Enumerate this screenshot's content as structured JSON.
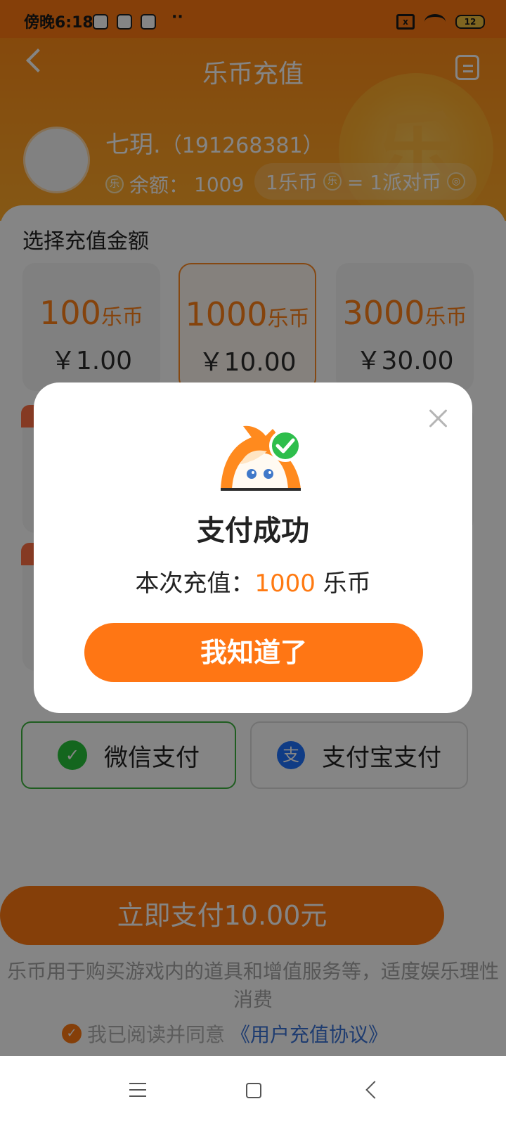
{
  "status_bar": {
    "time": "傍晚6:18",
    "dots": "··",
    "battery": "12",
    "sim": "x"
  },
  "header": {
    "title": "乐币充值",
    "username": "七玥.",
    "user_id": "（191268381）",
    "balance_label": "余额：",
    "balance": "1009",
    "rate_left": "1乐币",
    "rate_right": "= 1派对币",
    "coin_symbol": "乐"
  },
  "recharge": {
    "section_title": "选择充值金额",
    "packages": [
      {
        "coins": "100",
        "unit": "乐币",
        "price": "￥1.00"
      },
      {
        "coins": "1000",
        "unit": "乐币",
        "price": "￥10.00"
      },
      {
        "coins": "3000",
        "unit": "乐币",
        "price": "￥30.00"
      }
    ]
  },
  "payment": {
    "wechat": "微信支付",
    "alipay": "支付宝支付",
    "wechat_icon": "✓",
    "alipay_icon": "支"
  },
  "footer": {
    "pay_button": "立即支付10.00元",
    "notice": "乐币用于购买游戏内的道具和增值服务等，适度娱乐理性消费",
    "agreement_prefix": "我已阅读并同意",
    "agreement_link": "《用户充值协议》"
  },
  "modal": {
    "title": "支付成功",
    "summary_prefix": "本次充值：",
    "amount": "1000",
    "unit": "乐币",
    "confirm": "我知道了"
  },
  "colors": {
    "accent": "#ff7a12",
    "success": "#31b545",
    "link": "#3b73d6"
  }
}
